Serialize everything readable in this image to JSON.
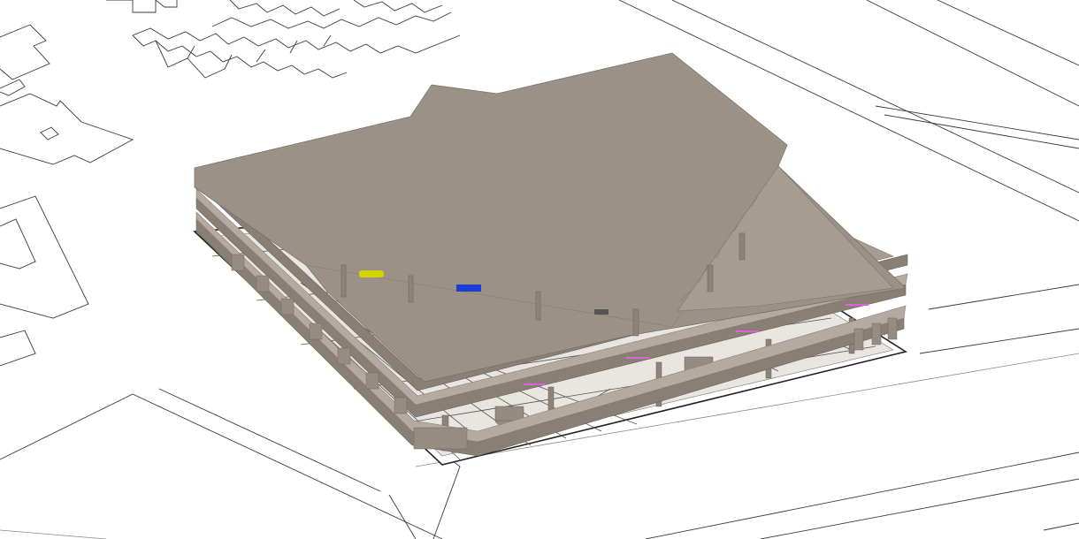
{
  "viewport": {
    "background_color": "#ffffff",
    "model": {
      "slab_color": "#9c9186",
      "edge_color": "#8a7f74",
      "outline_color": "#222222"
    },
    "markers": [
      {
        "name": "yellow-marker",
        "color": "#d4d400"
      },
      {
        "name": "blue-marker",
        "color": "#1a3fd0"
      },
      {
        "name": "gray-marker",
        "color": "#555555"
      },
      {
        "name": "magenta-marker-1",
        "color": "#e060e0"
      },
      {
        "name": "magenta-marker-2",
        "color": "#e060e0"
      },
      {
        "name": "magenta-marker-3",
        "color": "#e060e0"
      },
      {
        "name": "magenta-marker-4",
        "color": "#e060e0"
      }
    ]
  }
}
